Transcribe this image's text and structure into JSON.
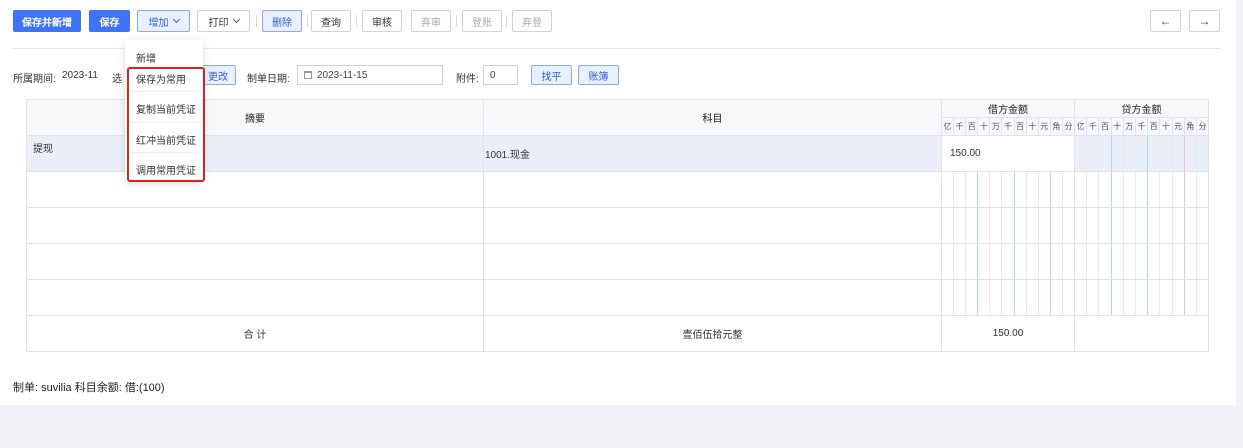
{
  "toolbar": {
    "save_new": "保存并新增",
    "save": "保存",
    "add": "增加",
    "print": "打印",
    "delete": "删除",
    "query": "查询",
    "audit": "审核",
    "unaudit": "弃审",
    "post": "登账",
    "unpost": "弃登",
    "prev_icon": "arrow-left-icon",
    "next_icon": "arrow-right-icon"
  },
  "add_menu": {
    "items": [
      "新增",
      "保存为常用",
      "复制当前凭证",
      "红冲当前凭证",
      "调用常用凭证"
    ]
  },
  "info": {
    "period_label": "所属期间:",
    "period_value": "2023-11",
    "select_label": "选",
    "change_btn": "更改",
    "date_label": "制单日期:",
    "date_value": "2023-11-15",
    "attach_label": "附件:",
    "attach_value": "0",
    "balance_btn": "找平",
    "ledger_btn": "账簿"
  },
  "table": {
    "col_summary": "摘要",
    "col_account": "科目",
    "col_debit": "借方金额",
    "col_credit": "贷方金额",
    "digits": [
      "亿",
      "千",
      "百",
      "十",
      "万",
      "千",
      "百",
      "十",
      "元",
      "角",
      "分"
    ],
    "rows": [
      {
        "summary": "提现",
        "account": "1001.现金",
        "debit": "150.00",
        "credit": ""
      }
    ],
    "total_label": "合 计",
    "total_words": "壹佰伍拾元整",
    "total_debit": "150.00",
    "total_credit": ""
  },
  "footer": {
    "text": "制单:  suvilia    科目余额:  借:(100)"
  },
  "colors": {
    "primary": "#3f72f5",
    "highlight": "#e02020"
  }
}
